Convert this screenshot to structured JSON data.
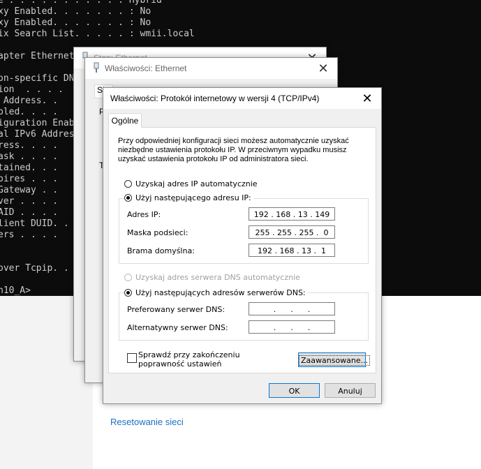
{
  "terminal": {
    "lines": [
      "e . . . . . . . . . . : Hybrid",
      "xy Enabled. . . . . . . : No",
      "xy Enabled. . . . . . . : No",
      "ix Search List. . . . . : wmii.local",
      "",
      "apter Ethernet",
      "",
      "on-specific DN",
      "ion  . . . .",
      " Address. .",
      "bled. . . .",
      "iguration Enab",
      "al IPv6 Addres",
      "ress. . . .",
      "ask . . . .",
      "tained. . .",
      "pires . . .",
      "Gateway . .",
      "ver . . . .",
      "AID . . . .",
      "lient DUID. .",
      "ers . . . .",
      "",
      "",
      "over Tcpip. .",
      "",
      "n10_A>"
    ]
  },
  "background_settings": {
    "link": "Resetowanie sieci"
  },
  "window_status": {
    "title": "Stan: Ethernet"
  },
  "window_properties": {
    "title": "Właściwości: Ethernet",
    "tab": "Sie",
    "letter_p": "P",
    "letter_t": "T"
  },
  "dialog": {
    "title": "Właściwości: Protokół internetowy w wersji 4 (TCP/IPv4)",
    "tab_general": "Ogólne",
    "description": "Przy odpowiedniej konfiguracji sieci możesz automatycznie uzyskać niezbędne ustawienia protokołu IP. W przeciwnym wypadku musisz uzyskać ustawienia protokołu IP od administratora sieci.",
    "radio_auto_ip": "Uzyskaj adres IP automatycznie",
    "radio_manual_ip": "Użyj następującego adresu IP:",
    "label_ip": "Adres IP:",
    "value_ip": "192 . 168 . 13 . 149",
    "label_mask": "Maska podsieci:",
    "value_mask": "255 . 255 . 255 .  0",
    "label_gateway": "Brama domyślna:",
    "value_gateway": "192 . 168 . 13 .  1",
    "radio_auto_dns": "Uzyskaj adres serwera DNS automatycznie",
    "radio_manual_dns": "Użyj następujących adresów serwerów DNS:",
    "label_pref_dns": "Preferowany serwer DNS:",
    "value_pref_dns": ".      .      .",
    "label_alt_dns": "Alternatywny serwer DNS:",
    "value_alt_dns": ".      .      .",
    "verify_label": "Sprawdź przy zakończeniu poprawność ustawień",
    "advanced_button": "Zaawansowane...",
    "ok_button": "OK",
    "cancel_button": "Anuluj",
    "close_glyph": "✕"
  }
}
